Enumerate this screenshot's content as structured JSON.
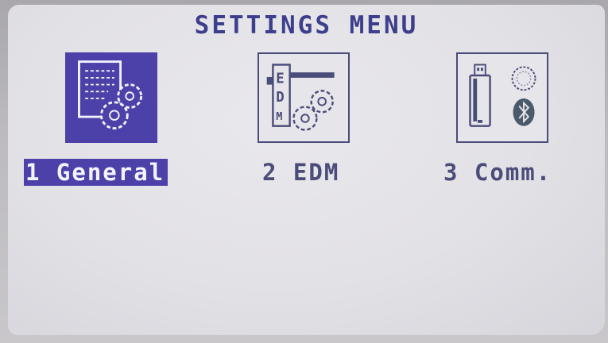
{
  "header": {
    "title": "SETTINGS MENU"
  },
  "menu": {
    "items": [
      {
        "label": "1 General",
        "icon": "general-settings-icon",
        "selected": true
      },
      {
        "label": "2 EDM",
        "icon": "edm-settings-icon",
        "selected": false
      },
      {
        "label": "3 Comm.",
        "icon": "communication-icon",
        "selected": false
      }
    ]
  },
  "colors": {
    "accent": "#4b41a8",
    "text": "#3d3f8c",
    "screen": "#e4e3e8"
  }
}
